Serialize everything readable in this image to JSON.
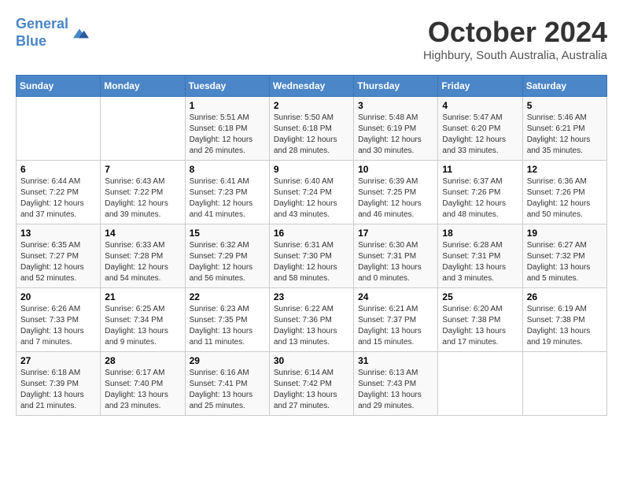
{
  "header": {
    "logo_line1": "General",
    "logo_line2": "Blue",
    "month": "October 2024",
    "location": "Highbury, South Australia, Australia"
  },
  "days_of_week": [
    "Sunday",
    "Monday",
    "Tuesday",
    "Wednesday",
    "Thursday",
    "Friday",
    "Saturday"
  ],
  "weeks": [
    [
      {
        "day": "",
        "info": ""
      },
      {
        "day": "",
        "info": ""
      },
      {
        "day": "1",
        "info": "Sunrise: 5:51 AM\nSunset: 6:18 PM\nDaylight: 12 hours\nand 26 minutes."
      },
      {
        "day": "2",
        "info": "Sunrise: 5:50 AM\nSunset: 6:18 PM\nDaylight: 12 hours\nand 28 minutes."
      },
      {
        "day": "3",
        "info": "Sunrise: 5:48 AM\nSunset: 6:19 PM\nDaylight: 12 hours\nand 30 minutes."
      },
      {
        "day": "4",
        "info": "Sunrise: 5:47 AM\nSunset: 6:20 PM\nDaylight: 12 hours\nand 33 minutes."
      },
      {
        "day": "5",
        "info": "Sunrise: 5:46 AM\nSunset: 6:21 PM\nDaylight: 12 hours\nand 35 minutes."
      }
    ],
    [
      {
        "day": "6",
        "info": "Sunrise: 6:44 AM\nSunset: 7:22 PM\nDaylight: 12 hours\nand 37 minutes."
      },
      {
        "day": "7",
        "info": "Sunrise: 6:43 AM\nSunset: 7:22 PM\nDaylight: 12 hours\nand 39 minutes."
      },
      {
        "day": "8",
        "info": "Sunrise: 6:41 AM\nSunset: 7:23 PM\nDaylight: 12 hours\nand 41 minutes."
      },
      {
        "day": "9",
        "info": "Sunrise: 6:40 AM\nSunset: 7:24 PM\nDaylight: 12 hours\nand 43 minutes."
      },
      {
        "day": "10",
        "info": "Sunrise: 6:39 AM\nSunset: 7:25 PM\nDaylight: 12 hours\nand 46 minutes."
      },
      {
        "day": "11",
        "info": "Sunrise: 6:37 AM\nSunset: 7:26 PM\nDaylight: 12 hours\nand 48 minutes."
      },
      {
        "day": "12",
        "info": "Sunrise: 6:36 AM\nSunset: 7:26 PM\nDaylight: 12 hours\nand 50 minutes."
      }
    ],
    [
      {
        "day": "13",
        "info": "Sunrise: 6:35 AM\nSunset: 7:27 PM\nDaylight: 12 hours\nand 52 minutes."
      },
      {
        "day": "14",
        "info": "Sunrise: 6:33 AM\nSunset: 7:28 PM\nDaylight: 12 hours\nand 54 minutes."
      },
      {
        "day": "15",
        "info": "Sunrise: 6:32 AM\nSunset: 7:29 PM\nDaylight: 12 hours\nand 56 minutes."
      },
      {
        "day": "16",
        "info": "Sunrise: 6:31 AM\nSunset: 7:30 PM\nDaylight: 12 hours\nand 58 minutes."
      },
      {
        "day": "17",
        "info": "Sunrise: 6:30 AM\nSunset: 7:31 PM\nDaylight: 13 hours\nand 0 minutes."
      },
      {
        "day": "18",
        "info": "Sunrise: 6:28 AM\nSunset: 7:31 PM\nDaylight: 13 hours\nand 3 minutes."
      },
      {
        "day": "19",
        "info": "Sunrise: 6:27 AM\nSunset: 7:32 PM\nDaylight: 13 hours\nand 5 minutes."
      }
    ],
    [
      {
        "day": "20",
        "info": "Sunrise: 6:26 AM\nSunset: 7:33 PM\nDaylight: 13 hours\nand 7 minutes."
      },
      {
        "day": "21",
        "info": "Sunrise: 6:25 AM\nSunset: 7:34 PM\nDaylight: 13 hours\nand 9 minutes."
      },
      {
        "day": "22",
        "info": "Sunrise: 6:23 AM\nSunset: 7:35 PM\nDaylight: 13 hours\nand 11 minutes."
      },
      {
        "day": "23",
        "info": "Sunrise: 6:22 AM\nSunset: 7:36 PM\nDaylight: 13 hours\nand 13 minutes."
      },
      {
        "day": "24",
        "info": "Sunrise: 6:21 AM\nSunset: 7:37 PM\nDaylight: 13 hours\nand 15 minutes."
      },
      {
        "day": "25",
        "info": "Sunrise: 6:20 AM\nSunset: 7:38 PM\nDaylight: 13 hours\nand 17 minutes."
      },
      {
        "day": "26",
        "info": "Sunrise: 6:19 AM\nSunset: 7:38 PM\nDaylight: 13 hours\nand 19 minutes."
      }
    ],
    [
      {
        "day": "27",
        "info": "Sunrise: 6:18 AM\nSunset: 7:39 PM\nDaylight: 13 hours\nand 21 minutes."
      },
      {
        "day": "28",
        "info": "Sunrise: 6:17 AM\nSunset: 7:40 PM\nDaylight: 13 hours\nand 23 minutes."
      },
      {
        "day": "29",
        "info": "Sunrise: 6:16 AM\nSunset: 7:41 PM\nDaylight: 13 hours\nand 25 minutes."
      },
      {
        "day": "30",
        "info": "Sunrise: 6:14 AM\nSunset: 7:42 PM\nDaylight: 13 hours\nand 27 minutes."
      },
      {
        "day": "31",
        "info": "Sunrise: 6:13 AM\nSunset: 7:43 PM\nDaylight: 13 hours\nand 29 minutes."
      },
      {
        "day": "",
        "info": ""
      },
      {
        "day": "",
        "info": ""
      }
    ]
  ]
}
